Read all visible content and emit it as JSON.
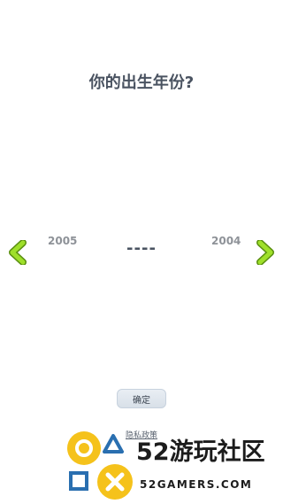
{
  "question": {
    "title": "你的出生年份?"
  },
  "year_picker": {
    "previous_year": "2005",
    "current_year": "----",
    "next_year": "2004",
    "left_arrow_icon": "chevron-left-icon",
    "right_arrow_icon": "chevron-right-icon",
    "arrow_color": "#8fd11f"
  },
  "confirm_button": {
    "label": "确定"
  },
  "privacy": {
    "label": "隐私政策"
  },
  "watermark": {
    "brand": "52游玩社区",
    "url": "52GAMERS.COM",
    "badge_color": "#f5c21b"
  }
}
